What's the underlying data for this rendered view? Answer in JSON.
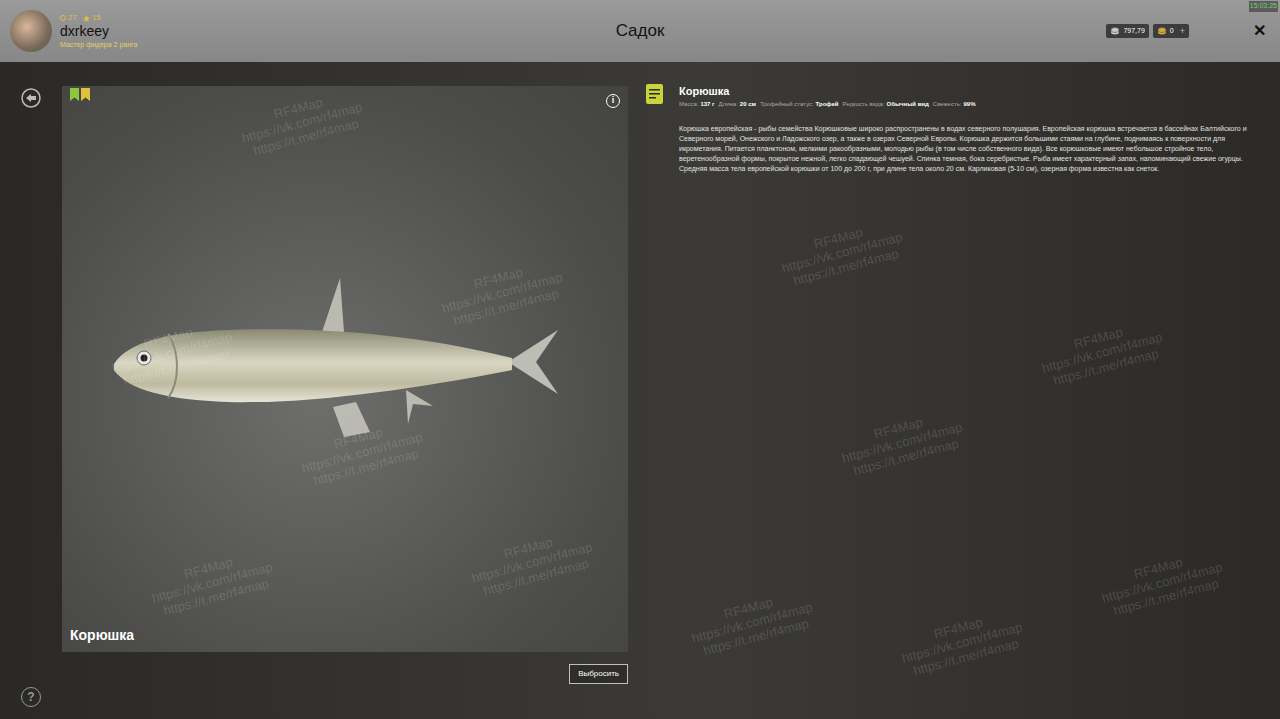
{
  "header": {
    "title": "Садок",
    "clock": "15:03:25",
    "player": {
      "name": "dxrkeey",
      "rank": "Мастер фидера 2 ранга",
      "level": "27",
      "stars": "15"
    },
    "currency": [
      {
        "amount": "797,79",
        "kind": "silver"
      },
      {
        "amount": "0",
        "kind": "gold"
      }
    ],
    "add_button": "+",
    "close_button": "✕"
  },
  "fish_card": {
    "name": "Корюшка",
    "info_button": "i",
    "badges": [
      {
        "color": "#8fc63f"
      },
      {
        "color": "#e0c23a"
      }
    ]
  },
  "discard_button": "Выбросить",
  "help_button": "?",
  "details": {
    "title": "Корюшка",
    "stats": [
      {
        "label": "Масса:",
        "value": "137 г"
      },
      {
        "label": "Длина:",
        "value": "20 см"
      },
      {
        "label": "Трофейный статус:",
        "value": "Трофей"
      },
      {
        "label": "Редкость вида:",
        "value": "Обычный вид"
      },
      {
        "label": "Свежесть:",
        "value": "99%"
      }
    ],
    "description": "Корюшка европейская - рыбы семейства Корюшковые широко распространены в водах северного полушария. Европейская корюшка встречается в бассейнах Балтийского и Северного морей, Онежского и Ладожского озер, а также в озерах Северной Европы. Корюшка держится большими стаями на глубине, поднимаясь к поверхности для икрометания. Питается планктоном, мелкими ракообразными, молодью рыбы (в том числе собственного вида). Все корюшковые имеют небольшое стройное тело, веретенообразной формы, покрытое нежной, легко спадающей чешуей. Спинка темная, бока серебристые. Рыба имеет характерный запах, напоминающий свежие огурцы. Средняя масса тела европейской корюшки от 100 до 200 г, при длине тела около 20 см. Карликовая (5-10 см), озерная форма известна как снеток."
  },
  "watermark": [
    "RF4Map",
    "https://vk.com/rf4map",
    "https://t.me/rf4map"
  ]
}
